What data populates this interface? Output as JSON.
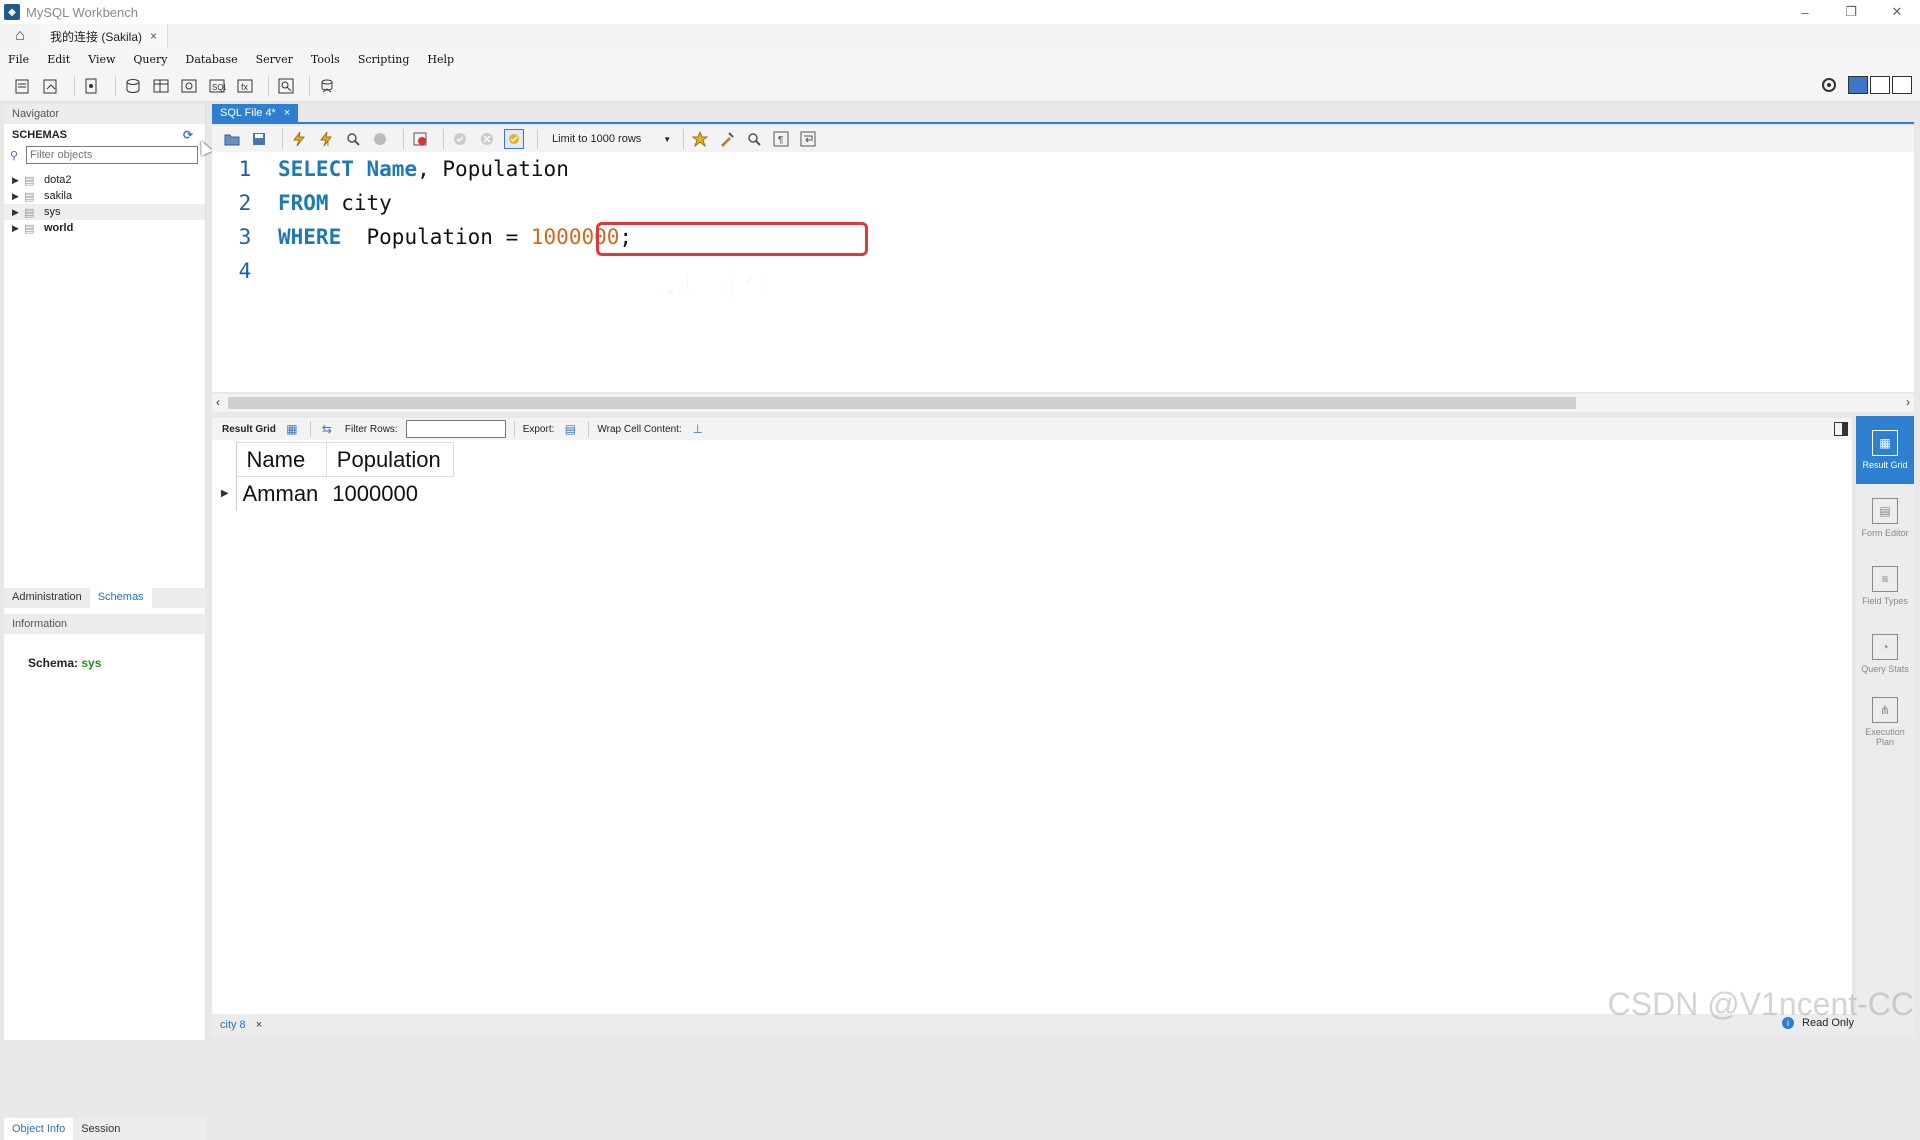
{
  "window": {
    "title": "MySQL Workbench",
    "controls": [
      "–",
      "❐",
      "✕"
    ]
  },
  "connection_tab": {
    "label": "我的连接 (Sakila)",
    "close": "×"
  },
  "menu": [
    "File",
    "Edit",
    "View",
    "Query",
    "Database",
    "Server",
    "Tools",
    "Scripting",
    "Help"
  ],
  "sidebar": {
    "navigator_label": "Navigator",
    "schemas_title": "SCHEMAS",
    "filter_placeholder": "Filter objects",
    "schemas": [
      {
        "name": "dota2",
        "selected": false,
        "bold": false
      },
      {
        "name": "sakila",
        "selected": false,
        "bold": false
      },
      {
        "name": "sys",
        "selected": true,
        "bold": false
      },
      {
        "name": "world",
        "selected": false,
        "bold": true
      }
    ],
    "tabs": [
      "Administration",
      "Schemas"
    ],
    "information_label": "Information",
    "info_schema_label": "Schema:",
    "info_schema_value": "sys",
    "bottom_tabs": [
      "Object Info",
      "Session"
    ]
  },
  "editor": {
    "tab_label": "SQL File 4*",
    "tab_close": "×",
    "limit_label": "Limit to 1000 rows",
    "lines": [
      {
        "num": "1",
        "t1": "SELECT",
        "t2": "Name",
        "t3": ",",
        "t4": "Population"
      },
      {
        "num": "2",
        "t1": "FROM",
        "t2": "",
        "t3": "",
        "t4": "city"
      },
      {
        "num": "3",
        "t1": "WHERE",
        "t2": "Population =",
        "t3": "1000000",
        "t4": ";"
      },
      {
        "num": "4",
        "t1": "",
        "t2": "",
        "t3": "",
        "t4": ""
      }
    ],
    "annotation": "过滤条件"
  },
  "result_toolbar": {
    "result_grid": "Result Grid",
    "filter_rows": "Filter Rows:",
    "export": "Export:",
    "wrap": "Wrap Cell Content:"
  },
  "result": {
    "columns": [
      "Name",
      "Population"
    ],
    "rows": [
      [
        "Amman",
        "1000000"
      ]
    ]
  },
  "right_panel": [
    {
      "label": "Result Grid",
      "active": true
    },
    {
      "label": "Form Editor",
      "active": false
    },
    {
      "label": "Field Types",
      "active": false
    },
    {
      "label": "Query Stats",
      "active": false
    },
    {
      "label": "Execution Plan",
      "active": false
    }
  ],
  "status": {
    "result_tab": "city 8",
    "result_tab_close": "×",
    "read_only": "Read Only"
  },
  "watermark": "CSDN @V1ncent-CC",
  "colors": {
    "accent": "#2e7fd0",
    "keyword": "#1e79b5",
    "number": "#d2691e",
    "annotation_red": "#e0383b"
  }
}
